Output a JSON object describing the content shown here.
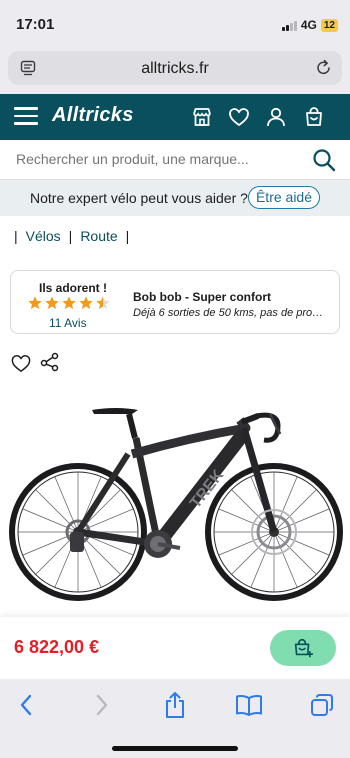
{
  "status": {
    "time": "17:01",
    "network": "4G",
    "battery": "12"
  },
  "browser": {
    "url": "alltricks.fr"
  },
  "header": {
    "logo": "Alltricks"
  },
  "search": {
    "placeholder": "Rechercher un produit, une marque..."
  },
  "expert_banner": {
    "text": "Notre expert vélo peut vous aider ? ➔",
    "button": "Être aidé"
  },
  "breadcrumb": {
    "sep": "|",
    "items": [
      "Vélos",
      "Route"
    ]
  },
  "reviews": {
    "heading": "Ils adorent !",
    "rating": 4.5,
    "count_label": "11 Avis",
    "review_title": "Bob bob - Super confort",
    "review_text": "Déjà 6 sorties de 50 kms, pas de probl..."
  },
  "product": {
    "price": "6 822,00 €",
    "frame_brand": "TREK"
  },
  "colors": {
    "brand_dark": "#0a4f5d",
    "price_red": "#e41e26",
    "cart_green": "#7fddb0",
    "link_blue": "#1f7aa8",
    "star_orange": "#f29a1a"
  }
}
